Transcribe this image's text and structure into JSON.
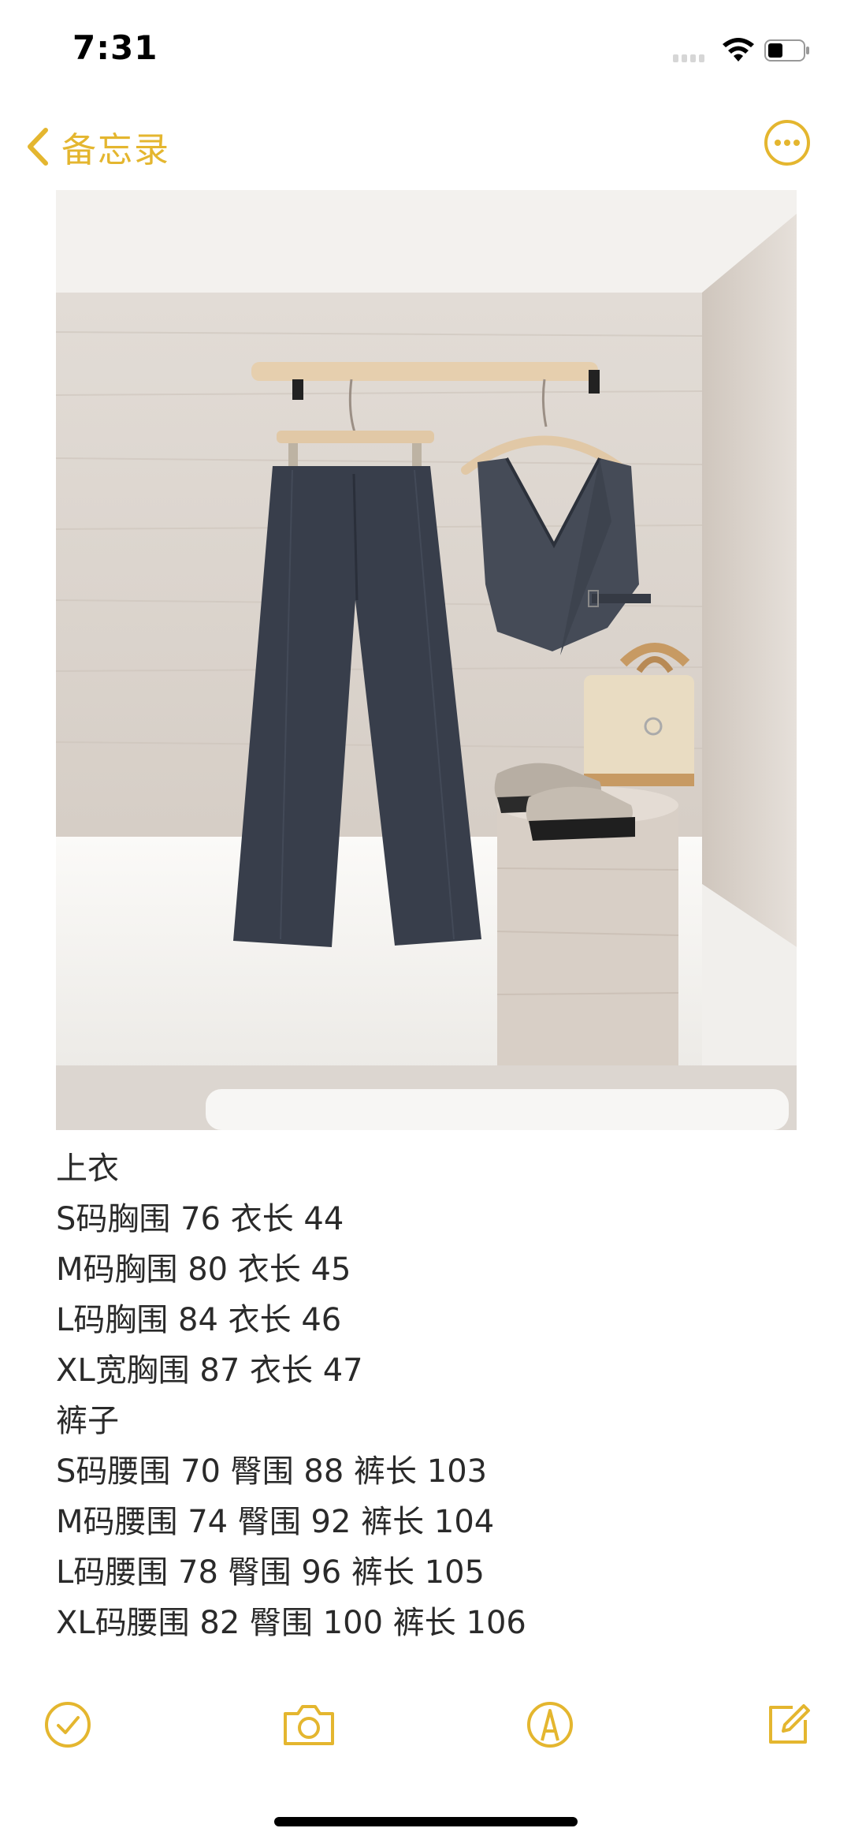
{
  "status_bar": {
    "time": "7:31"
  },
  "nav": {
    "back_label": "备忘录"
  },
  "note": {
    "lines": [
      "上衣",
      "S码胸围 76 衣长 44",
      "M码胸围 80 衣长 45",
      "L码胸围 84 衣长 46",
      "XL宽胸围 87 衣长 47",
      "裤子",
      "S码腰围 70 臀围 88 裤长 103",
      "M码腰围 74 臀围 92 裤长 104",
      "L码腰围 78 臀围 96 裤长 105",
      "XL码腰围 82 臀围 100 裤长 106"
    ]
  },
  "toolbar": {
    "items": [
      "checklist-icon",
      "camera-icon",
      "markup-icon",
      "compose-icon"
    ]
  },
  "colors": {
    "accent": "#e4b62f",
    "text": "#2a2a2a"
  }
}
